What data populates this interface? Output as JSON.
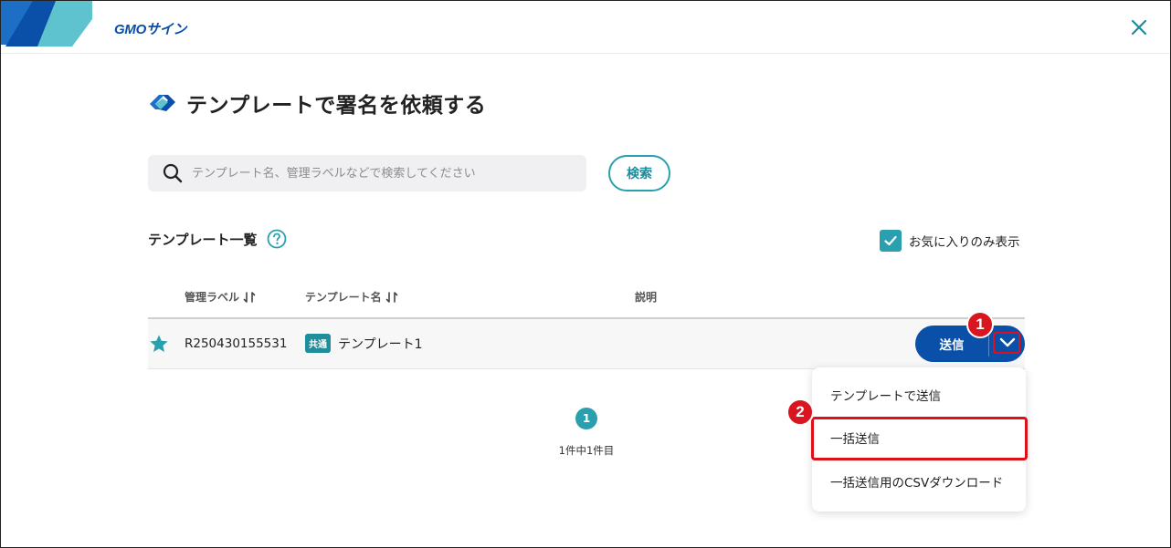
{
  "header": {
    "brand": "GMOサイン",
    "colors": {
      "brand_blue": "#0a4fa8",
      "brand_teal": "#2aa0ae"
    }
  },
  "page": {
    "title": "テンプレートで署名を依頼する"
  },
  "search": {
    "placeholder": "テンプレート名、管理ラベルなどで検索してください",
    "button_label": "検索"
  },
  "list": {
    "title": "テンプレート一覧",
    "favorites_only_label": "お気に入りのみ表示",
    "favorites_only_checked": true,
    "columns": {
      "label": "管理ラベル",
      "name": "テンプレート名",
      "description": "説明"
    },
    "rows": [
      {
        "favorite": true,
        "label": "R250430155531",
        "badge": "共通",
        "name": "テンプレート1",
        "description": "",
        "send_label": "送信"
      }
    ]
  },
  "pagination": {
    "current_page": "1",
    "count_text": "1件中1件目"
  },
  "dropdown_menu": {
    "items": [
      {
        "label": "テンプレートで送信"
      },
      {
        "label": "一括送信"
      },
      {
        "label": "一括送信用のCSVダウンロード"
      }
    ]
  },
  "annotations": {
    "step1": "1",
    "step2": "2",
    "highlight_color": "#e0101b"
  }
}
